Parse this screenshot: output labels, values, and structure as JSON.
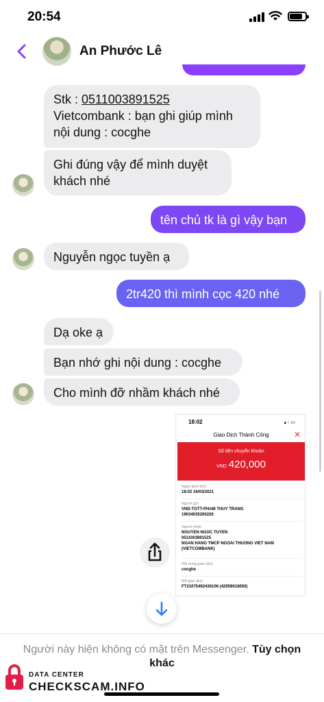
{
  "status_bar": {
    "time": "20:54"
  },
  "header": {
    "contact_name": "An Phước Lê"
  },
  "messages": [
    {
      "direction": "in",
      "lines": [
        "Stk : ",
        "0511003891525",
        "Vietcombank : bạn ghi giúp mình",
        "nội dung : cocghe"
      ]
    },
    {
      "direction": "in",
      "text": "Ghi đúng vậy để mình duyệt khách nhé"
    },
    {
      "direction": "out",
      "text": "tên chủ tk là gì vậy bạn",
      "color": "#7d48f3"
    },
    {
      "direction": "in",
      "text": "Nguyễn ngọc tuyền ạ"
    },
    {
      "direction": "out",
      "text": "2tr420 thì mình cọc 420 nhé",
      "color": "#6a63f2"
    },
    {
      "direction": "in",
      "text": "Dạ oke ạ"
    },
    {
      "direction": "in",
      "text": "Bạn nhớ ghi nội dung : cocghe"
    },
    {
      "direction": "in",
      "text": "Cho mình đỡ nhầm khách nhé"
    }
  ],
  "receipt": {
    "time": "18:02",
    "title": "Giao Dịch Thành Công",
    "amount_label": "Số tiền chuyển khoản",
    "currency": "VND",
    "amount": "420,000",
    "fields": [
      {
        "label": "Ngày giao dịch",
        "value": "18:02 16/03/2021"
      },
      {
        "label": "Người gửi",
        "value": "VND-TGTT-PHAM THUY TRANG",
        "value2": "19034035200226"
      },
      {
        "label": "Người nhận",
        "value": "NGUYEN NGOC TUYEN",
        "value2": "0511003891525",
        "value3": "NGAN HANG TMCP NGOAI THUONG VIET NAM",
        "value4": "(VIETCOMBANK)"
      },
      {
        "label": "Nội dung giao dịch",
        "value": "cocghe"
      },
      {
        "label": "Mã giao dịch",
        "value": "FT21075492436106 (42959018050)"
      }
    ]
  },
  "footer": {
    "notice": "Người này hiện không có mặt trên Messenger.",
    "action": "Tùy chọn khác"
  },
  "watermark": {
    "small": "DATA CENTER",
    "big": "CHECKSCAM.INFO"
  },
  "colors": {
    "accent": "#8a3ffc",
    "incoming_bubble": "#ececee",
    "receipt_red": "#e11d2a",
    "link_blue": "#2e7cf6"
  },
  "icons": [
    "back-icon",
    "share-icon",
    "arrow-down-icon",
    "lock-icon",
    "signal-icon",
    "wifi-icon",
    "battery-icon"
  ]
}
